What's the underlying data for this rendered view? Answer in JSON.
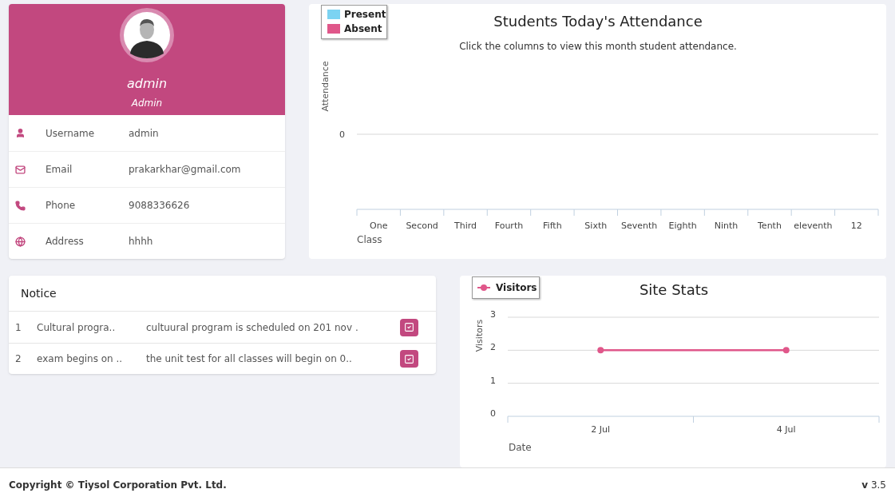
{
  "profile": {
    "name": "admin",
    "role": "Admin",
    "fields": [
      {
        "kind": "user",
        "label": "Username",
        "value": "admin"
      },
      {
        "kind": "mail",
        "label": "Email",
        "value": "prakarkhar@gmail.com"
      },
      {
        "kind": "phone",
        "label": "Phone",
        "value": "9088336626"
      },
      {
        "kind": "globe",
        "label": "Address",
        "value": "hhhh"
      }
    ]
  },
  "attendance": {
    "title": "Students Today's Attendance",
    "subtitle": "Click the columns to view this month student attendance.",
    "x_axis_title": "Class",
    "y_axis_title": "Attendance",
    "y_axis_label": "0",
    "categories": [
      "One",
      "Second",
      "Third",
      "Fourth",
      "Fifth",
      "Sixth",
      "Seventh",
      "Eighth",
      "Ninth",
      "Tenth",
      "eleventh",
      "12"
    ],
    "legend": [
      {
        "name": "Present",
        "color": "#7cd3f2"
      },
      {
        "name": "Absent",
        "color": "#e0578a"
      }
    ]
  },
  "notice": {
    "title": "Notice",
    "rows": [
      {
        "number": "1",
        "title": "Cultural progra..",
        "text": "cultuural program is scheduled on 201 nov ."
      },
      {
        "number": "2",
        "title": "exam begins on ..",
        "text": "the unit test for all classes will begin on 0.."
      }
    ]
  },
  "site_stats": {
    "chart_data": {
      "type": "line",
      "title": "Site Stats",
      "xlabel": "Date",
      "ylabel": "Visitors",
      "categories": [
        "2 Jul",
        "4 Jul"
      ],
      "yticks": [
        0,
        1,
        2,
        3
      ],
      "ylim": [
        0,
        3
      ],
      "series": [
        {
          "name": "Visitors",
          "color": "#e0578a",
          "marker": "circle",
          "values": [
            2,
            2
          ]
        }
      ]
    }
  },
  "footer": {
    "copyright": "Copyright © Tiysol Corporation Pvt. Ltd.",
    "version": "**v** 3.5"
  }
}
